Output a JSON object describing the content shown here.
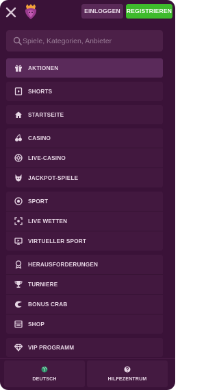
{
  "header": {
    "login_label": "EINLOGGEN",
    "register_label": "REGISTRIEREN"
  },
  "search": {
    "placeholder": "Spiele, Kategorien, Anbieter"
  },
  "menu": {
    "aktionen": "AKTIONEN",
    "shorts": "SHORTS",
    "startseite": "STARTSEITE",
    "casino": "CASINO",
    "live_casino": "LIVE-CASINO",
    "jackpot": "JACKPOT-SPIELE",
    "sport": "SPORT",
    "live_wetten": "LIVE WETTEN",
    "virtueller_sport": "VIRTUELLER SPORT",
    "herausforderungen": "HERAUSFORDERUNGEN",
    "turniere": "TURNIERE",
    "bonus_crab": "BONUS CRAB",
    "shop": "SHOP",
    "vip": "VIP PROGRAMM"
  },
  "footer": {
    "language_label": "DEUTSCH",
    "help_label": "HILFEZENTRUM"
  },
  "colors": {
    "background": "#3a1238",
    "item_bg": "#42183f",
    "active_item_bg": "#5a2a5a",
    "register_green": "#3ebb2c",
    "login_bg": "#5a2a58",
    "text": "#e7d6e5"
  }
}
